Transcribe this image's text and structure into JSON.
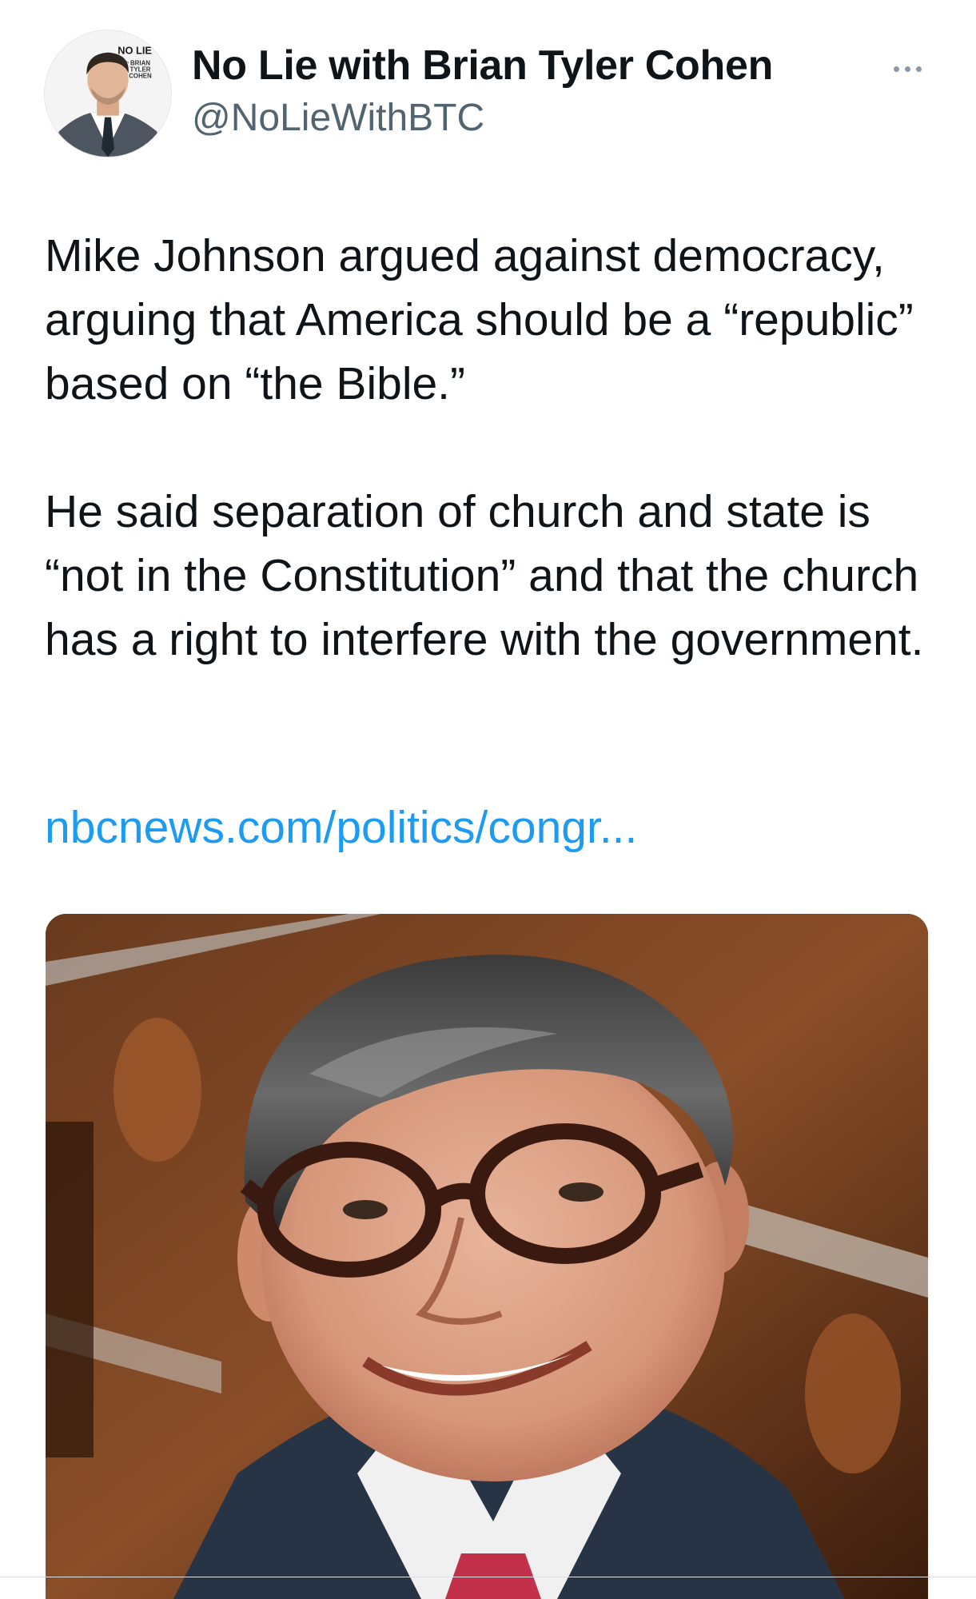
{
  "author": {
    "display_name": "No Lie with Brian Tyler Cohen",
    "handle": "@NoLieWithBTC",
    "avatar_badge_top": "NO LIE",
    "avatar_badge_sub": [
      "with",
      "BRIAN",
      "TYLER",
      "COHEN"
    ]
  },
  "tweet": {
    "paragraphs": [
      "Mike Johnson argued against democracy, arguing that America should be a “republic” based on “the Bible.”",
      "He said separation of church and state is “not in the Constitution” and that the church has a right to interfere with the government."
    ],
    "link_text": "nbcnews.com/politics/congr..."
  },
  "media": {
    "icon": "photo-of-man-with-glasses"
  },
  "colors": {
    "link": "#1d9bf0",
    "secondary_text": "#536471",
    "primary_text": "#0f1419"
  }
}
